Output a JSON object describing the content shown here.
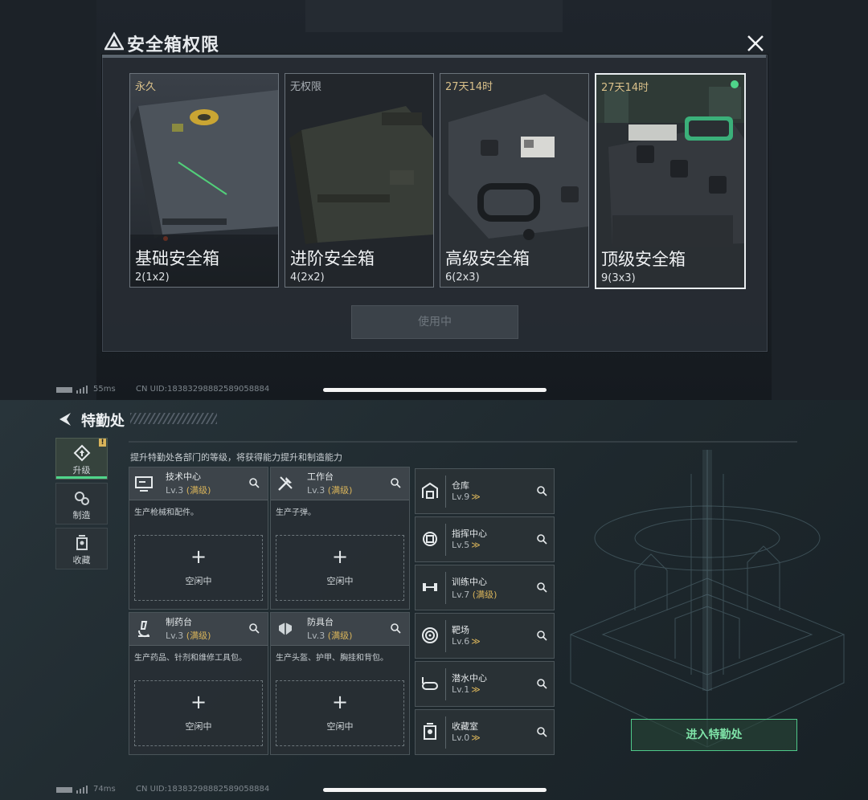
{
  "top": {
    "title": "安全箱权限",
    "cards": [
      {
        "tag": "永久",
        "name": "基础安全箱",
        "size": "2(1x2)"
      },
      {
        "tag": "无权限",
        "name": "进阶安全箱",
        "size": "4(2x2)"
      },
      {
        "tag": "27天14时",
        "name": "高级安全箱",
        "size": "6(2x3)"
      },
      {
        "tag": "27天14时",
        "name": "顶级安全箱",
        "size": "9(3x3)"
      }
    ],
    "use_button": "使用中",
    "status": {
      "ping": "55ms",
      "uid": "CN UID:18383298882589058884"
    }
  },
  "bottom": {
    "title": "特勤处",
    "badge": "!",
    "tabs": [
      {
        "label": "升级"
      },
      {
        "label": "制造"
      },
      {
        "label": "收藏"
      }
    ],
    "subtitle": "提升特勤处各部门的等级，将获得能力提升和制造能力",
    "facilities": [
      {
        "name": "技术中心",
        "level": "Lv.3",
        "max": "(满级)",
        "desc": "生产枪械和配件。",
        "slot": "空闲中",
        "icon": "monitor-icon"
      },
      {
        "name": "工作台",
        "level": "Lv.3",
        "max": "(满级)",
        "desc": "生产子弹。",
        "slot": "空闲中",
        "icon": "tools-icon"
      },
      {
        "name": "制药台",
        "level": "Lv.3",
        "max": "(满级)",
        "desc": "生产药品、针剂和维修工具包。",
        "slot": "空闲中",
        "icon": "microscope-icon"
      },
      {
        "name": "防具台",
        "level": "Lv.3",
        "max": "(满级)",
        "desc": "生产头盔、护甲、胸挂和背包。",
        "slot": "空闲中",
        "icon": "armor-icon"
      }
    ],
    "rows": [
      {
        "name": "仓库",
        "level": "Lv.9",
        "max": "",
        "icon": "warehouse-icon"
      },
      {
        "name": "指挥中心",
        "level": "Lv.5",
        "max": "",
        "icon": "chip-icon"
      },
      {
        "name": "训练中心",
        "level": "Lv.7",
        "max": "(满级)",
        "icon": "dumbbell-icon"
      },
      {
        "name": "靶场",
        "level": "Lv.6",
        "max": "",
        "icon": "target-icon"
      },
      {
        "name": "潜水中心",
        "level": "Lv.1",
        "max": "",
        "icon": "diving-mask-icon"
      },
      {
        "name": "收藏室",
        "level": "Lv.0",
        "max": "",
        "icon": "collection-icon"
      }
    ],
    "enter_button": "进入特勤处",
    "status": {
      "ping": "74ms",
      "uid": "CN UID:18383298882589058884"
    }
  },
  "colors": {
    "accent_green": "#4fd58a",
    "max_level": "#d9b45a",
    "timer": "#d9c08a"
  }
}
